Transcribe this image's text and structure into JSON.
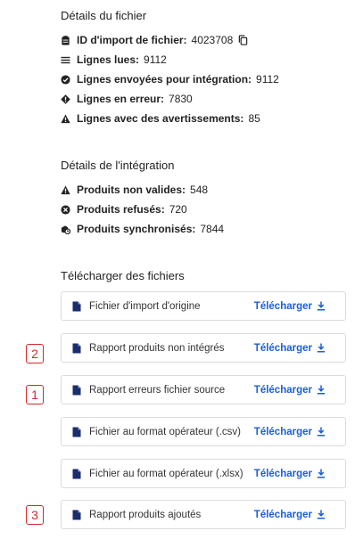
{
  "file_details": {
    "title": "Détails du fichier",
    "rows": [
      {
        "label": "ID d'import de fichier:",
        "value": "4023708"
      },
      {
        "label": "Lignes lues:",
        "value": "9112"
      },
      {
        "label": "Lignes envoyées pour intégration:",
        "value": "9112"
      },
      {
        "label": "Lignes en erreur:",
        "value": "7830"
      },
      {
        "label": "Lignes avec des avertissements:",
        "value": "85"
      }
    ]
  },
  "integration_details": {
    "title": "Détails de l'intégration",
    "rows": [
      {
        "label": "Produits non valides:",
        "value": "548"
      },
      {
        "label": "Produits refusés:",
        "value": "720"
      },
      {
        "label": "Produits synchronisés:",
        "value": "7844"
      }
    ]
  },
  "downloads": {
    "title": "Télécharger des fichiers",
    "files": [
      {
        "name": "Fichier d'import d'origine",
        "action": "Télécharger"
      },
      {
        "name": "Rapport produits non intégrés",
        "action": "Télécharger"
      },
      {
        "name": "Rapport erreurs fichier source",
        "action": "Télécharger"
      },
      {
        "name": "Fichier au format opérateur (.csv)",
        "action": "Télécharger"
      },
      {
        "name": "Fichier au format opérateur (.xlsx)",
        "action": "Télécharger"
      },
      {
        "name": "Rapport produits ajoutés",
        "action": "Télécharger"
      }
    ]
  },
  "annotations": [
    "2",
    "1",
    "3"
  ],
  "colors": {
    "link": "#1a5fd8",
    "annotation": "#d62828",
    "icon": "#1a2e6e"
  }
}
